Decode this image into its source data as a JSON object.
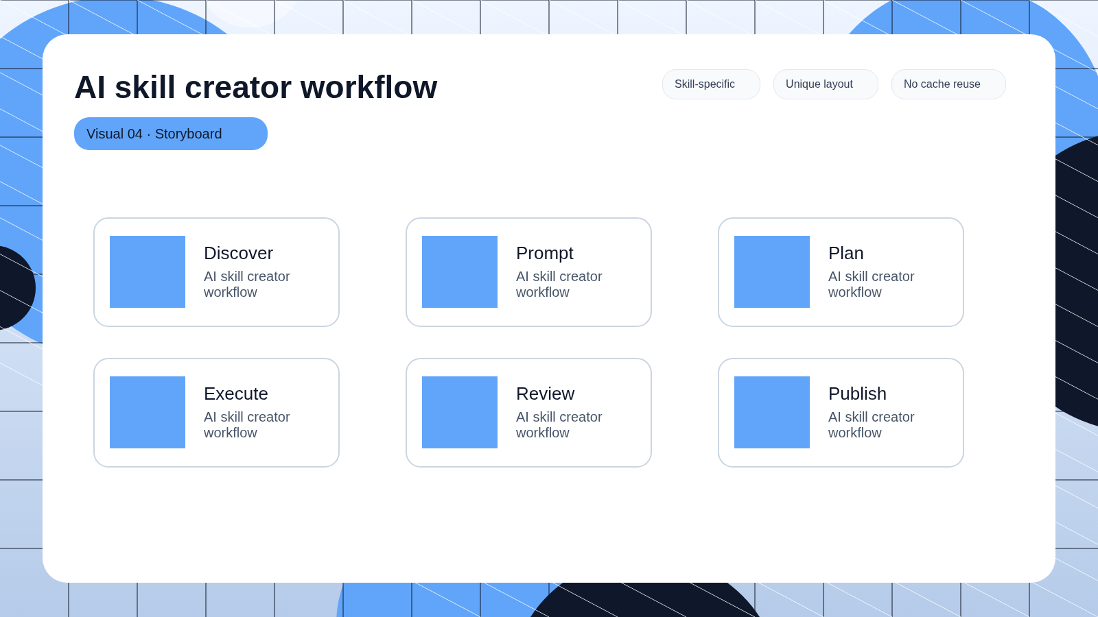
{
  "title": "AI skill creator workflow",
  "badge": "Visual 04 · Storyboard",
  "tags": [
    "Skill-specific",
    "Unique layout",
    "No cache reuse"
  ],
  "steps": [
    {
      "title": "Discover",
      "subtitle": "AI skill creator workflow"
    },
    {
      "title": "Prompt",
      "subtitle": "AI skill creator workflow"
    },
    {
      "title": "Plan",
      "subtitle": "AI skill creator workflow"
    },
    {
      "title": "Execute",
      "subtitle": "AI skill creator workflow"
    },
    {
      "title": "Review",
      "subtitle": "AI skill creator workflow"
    },
    {
      "title": "Publish",
      "subtitle": "AI skill creator workflow"
    }
  ]
}
